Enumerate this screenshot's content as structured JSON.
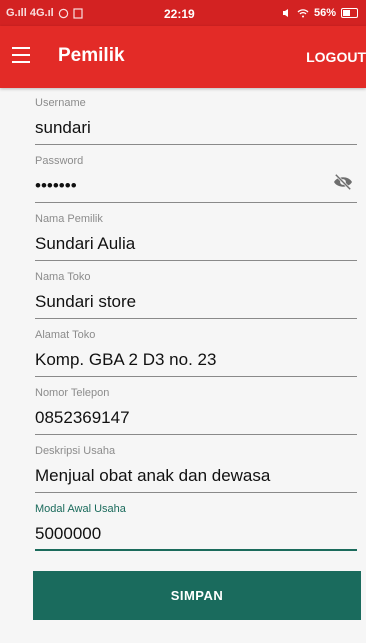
{
  "status_bar": {
    "signal_text": "G.ıll 4G.ıl",
    "time": "22:19",
    "battery": "56%"
  },
  "app_bar": {
    "title": "Pemilik",
    "logout_label": "LOGOUT"
  },
  "form": {
    "username": {
      "label": "Username",
      "value": "sundari"
    },
    "password": {
      "label": "Password",
      "value": "•••••••"
    },
    "owner_name": {
      "label": "Nama Pemilik",
      "value": "Sundari Aulia"
    },
    "store_name": {
      "label": "Nama Toko",
      "value": "Sundari store"
    },
    "store_address": {
      "label": "Alamat Toko",
      "value": "Komp. GBA 2 D3 no. 23"
    },
    "phone": {
      "label": "Nomor Telepon",
      "value": "0852369147"
    },
    "business_desc": {
      "label": "Deskripsi Usaha",
      "value": "Menjual obat anak dan dewasa"
    },
    "initial_capital": {
      "label": "Modal Awal Usaha",
      "value": "5000000"
    }
  },
  "save_button": {
    "label": "SIMPAN"
  },
  "colors": {
    "status_bar": "#d32222",
    "app_bar": "#e32b27",
    "accent": "#1a6b5d"
  },
  "icons": {
    "menu": "hamburger-menu-icon",
    "password_toggle": "eye-off-icon"
  }
}
